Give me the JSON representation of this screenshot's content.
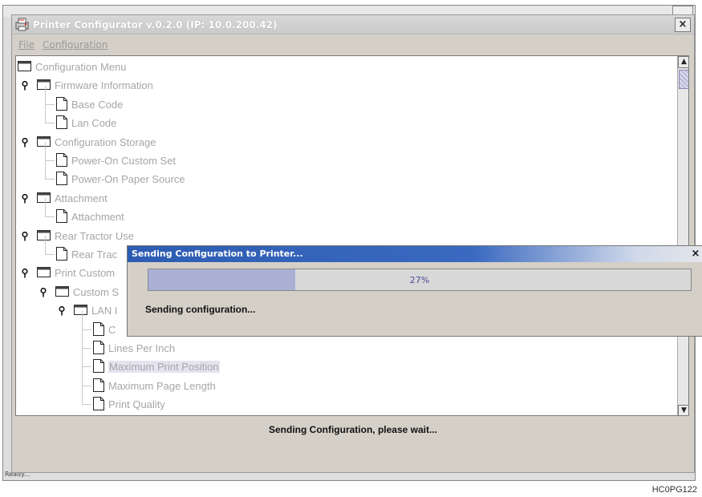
{
  "window": {
    "title": "Printer Configurator v.0.2.0 (IP: 10.0.200.42)",
    "close_glyph": "×"
  },
  "menu": {
    "file": "File",
    "configuration": "Configuration"
  },
  "tree": {
    "items": [
      {
        "label": "Configuration Menu",
        "type": "folder",
        "level": 0,
        "expanded": false
      },
      {
        "label": "Firmware Information",
        "type": "folder",
        "level": 0,
        "expanded": true
      },
      {
        "label": "Base Code",
        "type": "document",
        "level": 1
      },
      {
        "label": "Lan Code",
        "type": "document",
        "level": 1
      },
      {
        "label": "Configuration Storage",
        "type": "folder",
        "level": 0,
        "expanded": true
      },
      {
        "label": "Power-On Custom Set",
        "type": "document",
        "level": 1
      },
      {
        "label": "Power-On Paper Source",
        "type": "document",
        "level": 1
      },
      {
        "label": "Attachment",
        "type": "folder",
        "level": 0,
        "expanded": true
      },
      {
        "label": "Attachment",
        "type": "document",
        "level": 1
      },
      {
        "label": "Rear Tractor Use",
        "type": "folder",
        "level": 0,
        "expanded": true
      },
      {
        "label": "Rear Trac",
        "type": "document",
        "level": 1
      },
      {
        "label": "Print Custom",
        "type": "folder",
        "level": 0,
        "expanded": true
      },
      {
        "label": "Custom S",
        "type": "folder",
        "level": 1,
        "expanded": true
      },
      {
        "label": "LAN I",
        "type": "folder",
        "level": 2,
        "expanded": true
      },
      {
        "label": "C",
        "type": "document",
        "level": 3
      },
      {
        "label": "Lines Per Inch",
        "type": "document",
        "level": 3
      },
      {
        "label": "Maximum Print Position",
        "type": "document",
        "level": 3,
        "selected": true
      },
      {
        "label": "Maximum Page Length",
        "type": "document",
        "level": 3
      },
      {
        "label": "Print Quality",
        "type": "document",
        "level": 3
      }
    ]
  },
  "scrollbar": {
    "up_arrow": "▲",
    "down_arrow": "▼"
  },
  "status_message": "Sending Configuration, please wait...",
  "background_status": "Ready...",
  "dialog": {
    "title": "Sending Configuration to Printer...",
    "close_glyph": "×",
    "progress_percent": 27,
    "progress_text": "27%",
    "message": "Sending configuration..."
  },
  "figure_code": "HC0PG122",
  "colors": {
    "dialog_title_bar": "#2d5cb3",
    "progress_fill": "#aab0d6",
    "tree_text": "#a6a6a6",
    "selection_highlight": "#e4e4f0"
  }
}
